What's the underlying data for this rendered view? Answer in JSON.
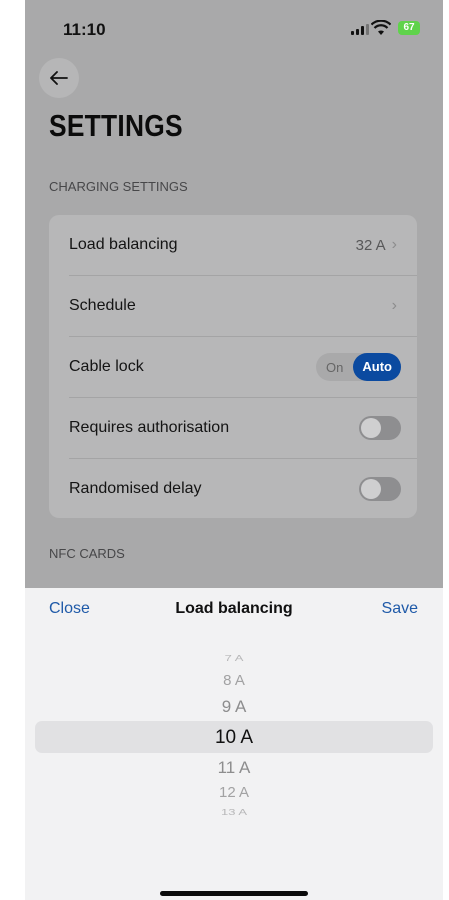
{
  "status_bar": {
    "time": "11:10",
    "battery": "67"
  },
  "page": {
    "title": "SETTINGS"
  },
  "charging": {
    "section_label": "CHARGING SETTINGS",
    "rows": [
      {
        "label": "Load balancing",
        "value": "32 A"
      },
      {
        "label": "Schedule",
        "value": ""
      },
      {
        "label": "Cable lock",
        "options": [
          "On",
          "Auto"
        ],
        "selected": "Auto"
      },
      {
        "label": "Requires authorisation",
        "toggle": false
      },
      {
        "label": "Randomised delay",
        "toggle": false
      }
    ]
  },
  "nfc": {
    "section_label": "NFC CARDS"
  },
  "sheet": {
    "close_label": "Close",
    "title": "Load balancing",
    "save_label": "Save",
    "options": [
      "7 A",
      "8 A",
      "9 A",
      "10 A",
      "11 A",
      "12 A",
      "13 A"
    ],
    "selected": "10 A"
  },
  "colors": {
    "accent": "#1f5aa8",
    "toggle_selected": "#0b4aa0"
  }
}
